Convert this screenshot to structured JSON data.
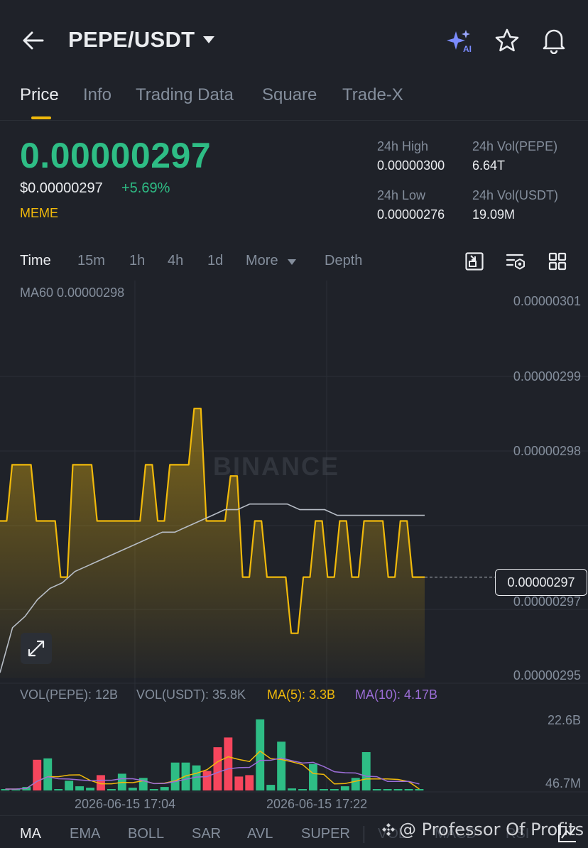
{
  "header": {
    "pair": "PEPE/USDT"
  },
  "tabs": [
    {
      "label": "Price",
      "active": true
    },
    {
      "label": "Info"
    },
    {
      "label": "Trading Data"
    },
    {
      "label": "Square"
    },
    {
      "label": "Trade-X"
    }
  ],
  "price": {
    "last": "0.00000297",
    "usd": "$0.00000297",
    "change": "+5.69%",
    "tag": "MEME",
    "color_up": "#2ebd85",
    "color_down": "#f6465d",
    "accent": "#f0b90b"
  },
  "stats": {
    "high_label": "24h High",
    "high_value": "0.00000300",
    "vol_base_label": "24h Vol(PEPE)",
    "vol_base_value": "6.64T",
    "low_label": "24h Low",
    "low_value": "0.00000276",
    "vol_quote_label": "24h Vol(USDT)",
    "vol_quote_value": "19.09M"
  },
  "intervals": [
    "Time",
    "15m",
    "1h",
    "4h",
    "1d",
    "More",
    "Depth"
  ],
  "chart": {
    "ma60_label": "MA60 0.00000298",
    "y_labels": [
      "0.00000301",
      "0.00000299",
      "0.00000298",
      "0.00000297",
      "0.00000295"
    ],
    "current_price": "0.00000297",
    "watermark": "BINANCE"
  },
  "volume": {
    "vol_base": "VOL(PEPE): 12B",
    "vol_quote": "VOL(USDT): 35.8K",
    "ma5": "MA(5): 3.3B",
    "ma10": "MA(10): 4.17B",
    "ma5_color": "#f0b90b",
    "ma10_color": "#9b6dd6",
    "y_top": "22.6B",
    "y_bottom": "46.7M"
  },
  "time_labels": [
    "2026-06-15 17:04",
    "2026-06-15 17:22"
  ],
  "indicators": [
    "MA",
    "EMA",
    "BOLL",
    "SAR",
    "AVL",
    "SUPER",
    "VOL",
    "MACD",
    "RSI"
  ],
  "credit": "@ Professor Of Profits",
  "chart_data": {
    "type": "line",
    "series": [
      {
        "values": [
          2.975,
          2.985,
          2.985,
          2.975,
          2.975,
          2.965,
          2.985,
          2.985,
          2.975,
          2.975,
          2.975,
          2.975,
          2.985,
          2.975,
          2.985,
          2.985,
          2.995,
          2.975,
          2.975,
          2.983,
          2.965,
          2.975,
          2.965,
          2.965,
          2.955,
          2.965,
          2.975,
          2.965,
          2.975,
          2.965,
          2.975,
          2.975,
          2.965,
          2.975,
          2.965
        ]
      },
      {
        "name": "MA60",
        "values": [
          2.948,
          2.956,
          2.958,
          2.961,
          2.963,
          2.964,
          2.966,
          2.967,
          2.968,
          2.969,
          2.97,
          2.971,
          2.972,
          2.973,
          2.973,
          2.974,
          2.975,
          2.976,
          2.977,
          2.977,
          2.978,
          2.978,
          2.978,
          2.978,
          2.977,
          2.977,
          2.977,
          2.976,
          2.976,
          2.976,
          2.976,
          2.976,
          2.976,
          2.976,
          2.976
        ]
      }
    ],
    "unit_note": "prices ×1e-6",
    "ylim": [
      2.947,
      3.015
    ],
    "volume": {
      "colors": [
        "#2ebd85",
        "#2ebd85",
        "#2ebd85",
        "#f6465d",
        "#2ebd85",
        "#2ebd85",
        "#2ebd85",
        "#2ebd85",
        "#2ebd85",
        "#f6465d",
        "#2ebd85",
        "#2ebd85",
        "#2ebd85",
        "#2ebd85",
        "#2ebd85",
        "#2ebd85",
        "#2ebd85",
        "#2ebd85",
        "#2ebd85",
        "#f6465d",
        "#f6465d",
        "#f6465d",
        "#f6465d",
        "#f6465d",
        "#2ebd85",
        "#2ebd85",
        "#2ebd85",
        "#2ebd85",
        "#2ebd85",
        "#2ebd85",
        "#2ebd85",
        "#2ebd85",
        "#2ebd85",
        "#2ebd85",
        "#2ebd85",
        "#2ebd85",
        "#2ebd85",
        "#2ebd85",
        "#2ebd85",
        "#2ebd85"
      ],
      "values": [
        0.2,
        0.2,
        0.5,
        4.4,
        4.6,
        0.2,
        1.4,
        0.6,
        0.4,
        2.2,
        0.2,
        2.4,
        0.4,
        1.8,
        0.2,
        0.5,
        4.0,
        4.0,
        3.6,
        2.8,
        6.2,
        7.6,
        2.0,
        2.2,
        10.2,
        0.8,
        7.0,
        0.3,
        0.2,
        3.8,
        0.2,
        0.2,
        0.6,
        1.8,
        5.5,
        0.2,
        0.2,
        0.2,
        0.2,
        0.2
      ],
      "ylim": [
        0,
        11
      ]
    }
  }
}
